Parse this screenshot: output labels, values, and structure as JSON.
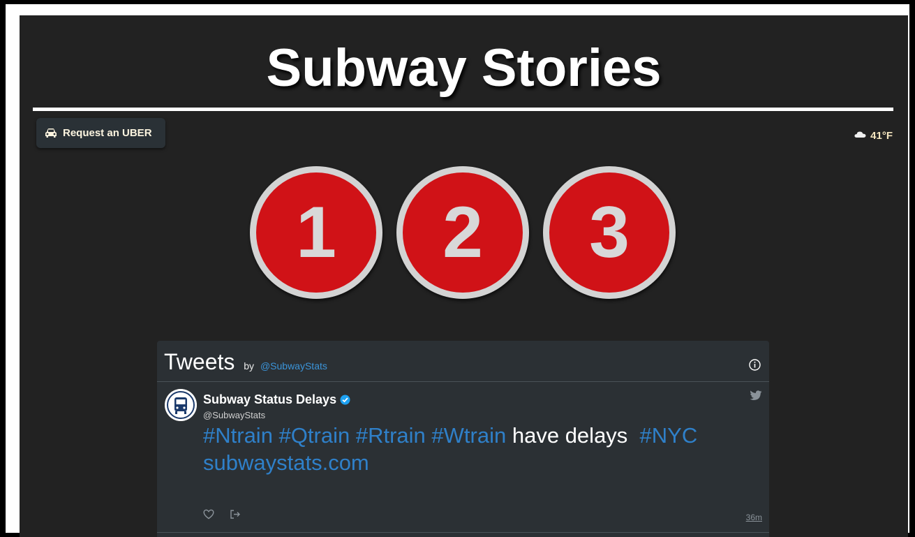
{
  "header": {
    "title": "Subway Stories"
  },
  "uber": {
    "label": "Request an UBER",
    "icon": "car-icon"
  },
  "weather": {
    "temperature": "41°F",
    "icon": "cloud-icon"
  },
  "lines": [
    {
      "label": "1",
      "color": "#d01217"
    },
    {
      "label": "2",
      "color": "#d01217"
    },
    {
      "label": "3",
      "color": "#d01217"
    }
  ],
  "tweets_widget": {
    "title": "Tweets",
    "by": "by",
    "by_handle": "@SubwayStats",
    "tweet": {
      "author_name": "Subway Status Delays",
      "author_handle": "@SubwayStats",
      "hashtags": [
        "#Ntrain",
        "#Qtrain",
        "#Rtrain",
        "#Wtrain"
      ],
      "text": "have delays",
      "hashtag_end": "#NYC",
      "link": "subwaystats.com",
      "time": "36m"
    }
  },
  "colors": {
    "background": "#222222",
    "bullet_red": "#d01217",
    "link_blue": "#2f80c9",
    "widget_bg": "#2b3034"
  }
}
